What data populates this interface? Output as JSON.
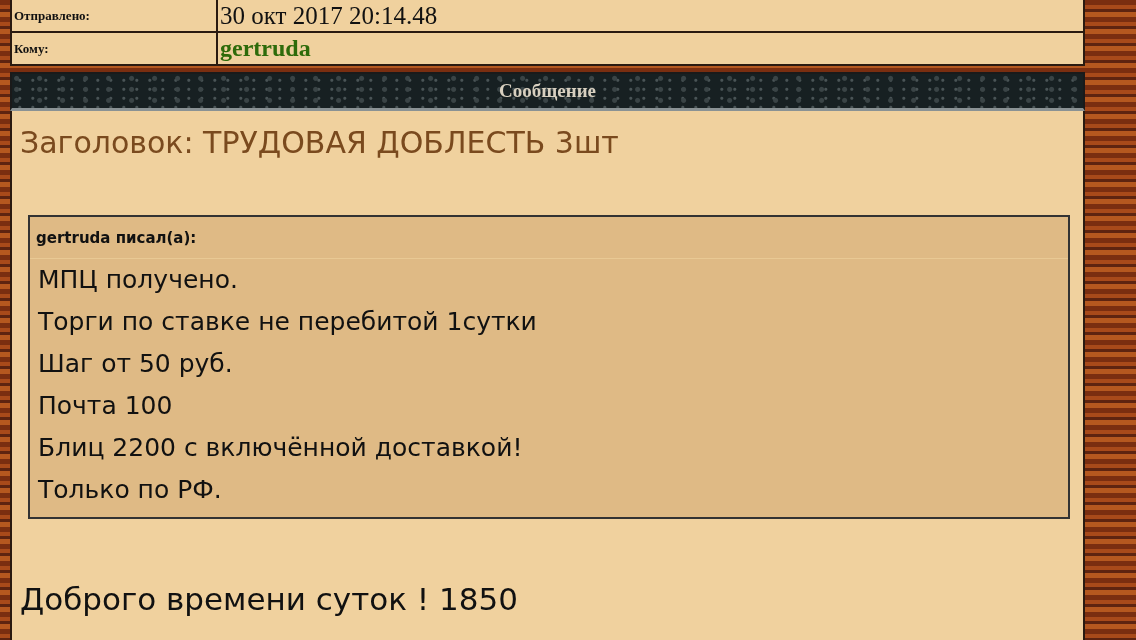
{
  "meta": [
    {
      "label": "Отправлено:",
      "value": "30 окт 2017 20:14.48",
      "kind": "date"
    },
    {
      "label": "Кому:",
      "value": "gertruda",
      "kind": "user"
    }
  ],
  "section_title": "Сообщение",
  "subject": "Заголовок: ТРУДОВАЯ ДОБЛЕСТЬ 3шт",
  "quote": {
    "author_line": "gertruda писал(а):",
    "lines": [
      "МПЦ получено.",
      "Торги по ставке не перебитой 1сутки",
      "Шаг от 50 руб.",
      "Почта 100",
      "Блиц 2200 с включённой доставкой!",
      "Только по РФ."
    ]
  },
  "body": "Доброго времени суток ! 1850"
}
